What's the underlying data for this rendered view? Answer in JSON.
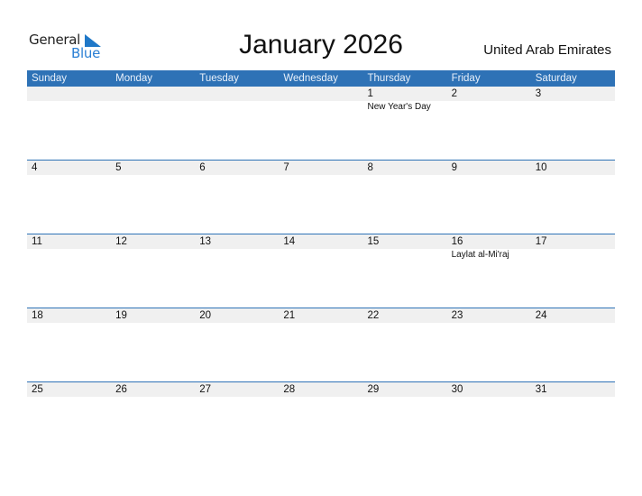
{
  "logo": {
    "line1": "General",
    "line2": "Blue",
    "icon": "triangle-flag-icon"
  },
  "title": "January 2026",
  "country": "United Arab Emirates",
  "colors": {
    "header_bg": "#2e72b6",
    "date_row_bg": "#f0f0f0",
    "logo_blue": "#2a7fd4"
  },
  "weekdays": [
    "Sunday",
    "Monday",
    "Tuesday",
    "Wednesday",
    "Thursday",
    "Friday",
    "Saturday"
  ],
  "weeks": [
    {
      "days": [
        "",
        "",
        "",
        "",
        "1",
        "2",
        "3"
      ],
      "events": [
        "",
        "",
        "",
        "",
        "New Year's Day",
        "",
        ""
      ]
    },
    {
      "days": [
        "4",
        "5",
        "6",
        "7",
        "8",
        "9",
        "10"
      ],
      "events": [
        "",
        "",
        "",
        "",
        "",
        "",
        ""
      ]
    },
    {
      "days": [
        "11",
        "12",
        "13",
        "14",
        "15",
        "16",
        "17"
      ],
      "events": [
        "",
        "",
        "",
        "",
        "",
        "Laylat al-Mi'raj",
        ""
      ]
    },
    {
      "days": [
        "18",
        "19",
        "20",
        "21",
        "22",
        "23",
        "24"
      ],
      "events": [
        "",
        "",
        "",
        "",
        "",
        "",
        ""
      ]
    },
    {
      "days": [
        "25",
        "26",
        "27",
        "28",
        "29",
        "30",
        "31"
      ],
      "events": [
        "",
        "",
        "",
        "",
        "",
        "",
        ""
      ]
    }
  ]
}
